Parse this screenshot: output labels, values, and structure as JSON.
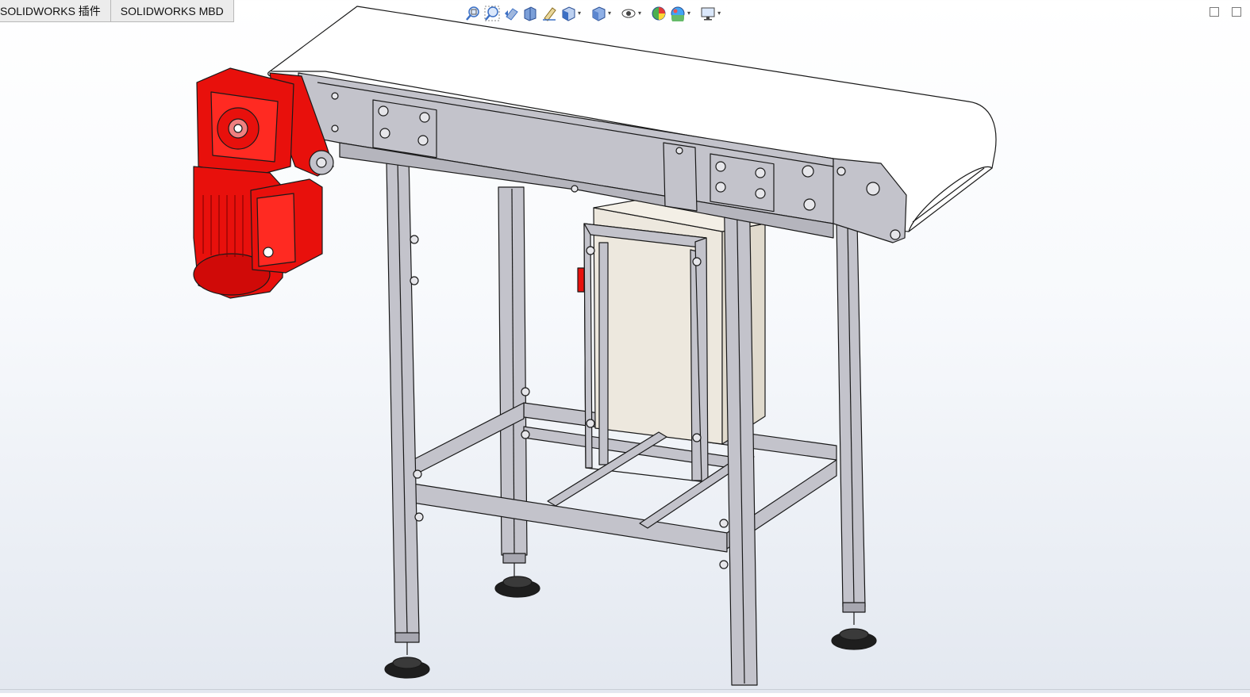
{
  "tabs": [
    {
      "label": "SOLIDWORKS 插件"
    },
    {
      "label": "SOLIDWORKS MBD"
    }
  ],
  "heads_up_toolbar": {
    "icons": [
      "zoom-to-fit-icon",
      "zoom-to-area-icon",
      "previous-view-icon",
      "section-view-icon",
      "dynamic-annotation-icon",
      "view-orientation-icon",
      "display-style-icon",
      "hide-show-items-icon",
      "edit-appearance-icon",
      "apply-scene-icon",
      "view-settings-icon"
    ]
  },
  "colors": {
    "motor_red": "#e8100c",
    "frame_gray": "#c3c3cb",
    "belt_white": "#ffffff",
    "cabinet_beige": "#ede8de",
    "foot_black": "#1e1e1e",
    "edge_black": "#1a1a1a",
    "icon_blue": "#3b6fc4"
  },
  "model": {
    "assembly": "belt-conveyor",
    "parts": [
      "conveyor-belt",
      "side-frame",
      "drive-motor",
      "gearbox",
      "support-legs",
      "cross-braces",
      "control-cabinet",
      "leveling-feet"
    ]
  }
}
